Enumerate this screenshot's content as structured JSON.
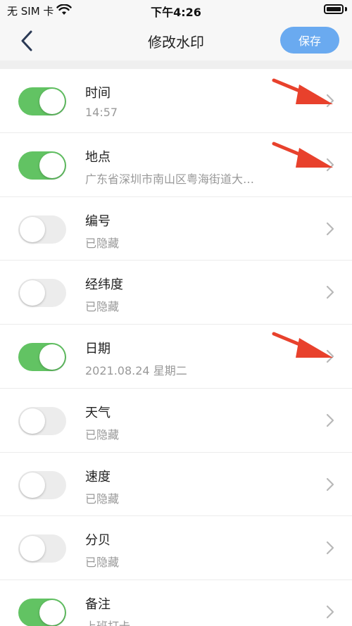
{
  "status": {
    "carrier": "无 SIM 卡",
    "time": "下午4:26"
  },
  "nav": {
    "title": "修改水印",
    "save_label": "保存"
  },
  "colors": {
    "toggle_on": "#62c363",
    "toggle_off": "#ececec",
    "accent": "#6aaaf0",
    "annotation": "#e8412c"
  },
  "rows": [
    {
      "title": "时间",
      "subtitle": "14:57",
      "enabled": true
    },
    {
      "title": "地点",
      "subtitle": "广东省深圳市南山区粤海街道大…",
      "enabled": true
    },
    {
      "title": "编号",
      "subtitle": "已隐藏",
      "enabled": false
    },
    {
      "title": "经纬度",
      "subtitle": "已隐藏",
      "enabled": false
    },
    {
      "title": "日期",
      "subtitle": "2021.08.24 星期二",
      "enabled": true
    },
    {
      "title": "天气",
      "subtitle": "已隐藏",
      "enabled": false
    },
    {
      "title": "速度",
      "subtitle": "已隐藏",
      "enabled": false
    },
    {
      "title": "分贝",
      "subtitle": "已隐藏",
      "enabled": false
    },
    {
      "title": "备注",
      "subtitle": "上班打卡",
      "enabled": true
    }
  ]
}
